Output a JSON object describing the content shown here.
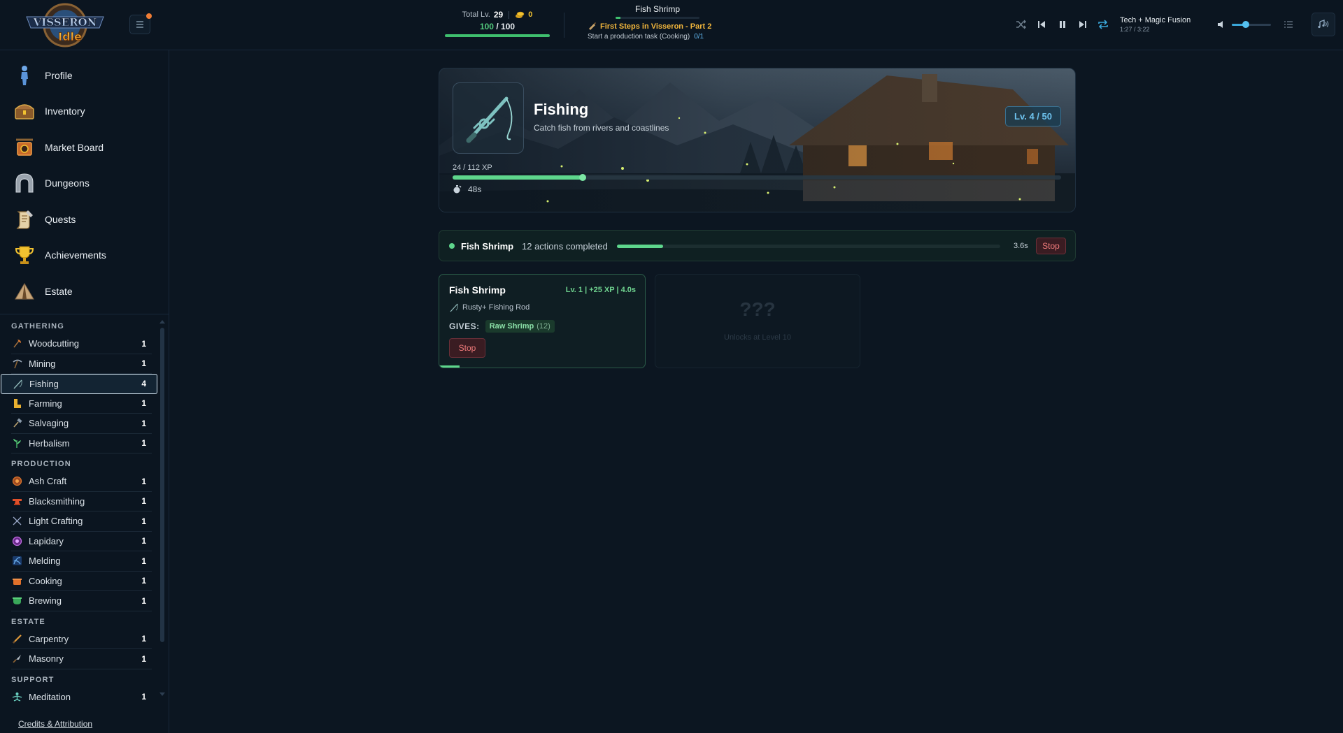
{
  "header": {
    "total_level_label": "Total Lv.",
    "total_level": "29",
    "gold": "0",
    "energy_current": "100",
    "energy_separator": "/",
    "energy_max": "100",
    "energy_fraction": 1.0,
    "current_action": "Fish Shrimp",
    "quest_progress_fraction": 0.06,
    "quest_name": "First Steps in Visseron - Part 2",
    "quest_task": "Start a production task (Cooking)",
    "quest_task_progress": "0/1",
    "player": {
      "track_title": "Tech + Magic Fusion",
      "track_time": "1:27 / 3:22",
      "volume_fraction": 0.35
    }
  },
  "sidebar": {
    "nav": [
      {
        "label": "Profile",
        "icon": "person-icon"
      },
      {
        "label": "Inventory",
        "icon": "chest-icon"
      },
      {
        "label": "Market Board",
        "icon": "market-icon"
      },
      {
        "label": "Dungeons",
        "icon": "gate-icon"
      },
      {
        "label": "Quests",
        "icon": "scroll-icon"
      },
      {
        "label": "Achievements",
        "icon": "trophy-icon"
      },
      {
        "label": "Estate",
        "icon": "tent-icon"
      }
    ],
    "sections": {
      "gathering": "GATHERING",
      "production": "PRODUCTION",
      "estate": "ESTATE",
      "support": "SUPPORT"
    },
    "gathering": [
      {
        "label": "Woodcutting",
        "level": "1"
      },
      {
        "label": "Mining",
        "level": "1"
      },
      {
        "label": "Fishing",
        "level": "4"
      },
      {
        "label": "Farming",
        "level": "1"
      },
      {
        "label": "Salvaging",
        "level": "1"
      },
      {
        "label": "Herbalism",
        "level": "1"
      }
    ],
    "production": [
      {
        "label": "Ash Craft",
        "level": "1"
      },
      {
        "label": "Blacksmithing",
        "level": "1"
      },
      {
        "label": "Light Crafting",
        "level": "1"
      },
      {
        "label": "Lapidary",
        "level": "1"
      },
      {
        "label": "Melding",
        "level": "1"
      },
      {
        "label": "Cooking",
        "level": "1"
      },
      {
        "label": "Brewing",
        "level": "1"
      }
    ],
    "estate": [
      {
        "label": "Carpentry",
        "level": "1"
      },
      {
        "label": "Masonry",
        "level": "1"
      }
    ],
    "support": [
      {
        "label": "Meditation",
        "level": "1"
      }
    ],
    "credits": "Credits & Attribution"
  },
  "hero": {
    "name": "Fishing",
    "description": "Catch fish from rivers and coastlines",
    "level_badge": "Lv. 4 / 50",
    "xp_text": "24 / 112 XP",
    "xp_fraction": 0.214,
    "timer": "48s"
  },
  "active_task": {
    "name": "Fish Shrimp",
    "count": "12 actions completed",
    "progress_fraction": 0.12,
    "time": "3.6s",
    "stop_label": "Stop"
  },
  "cards": {
    "action": {
      "name": "Fish Shrimp",
      "meta": "Lv. 1 | +25 XP | 4.0s",
      "tool": "Rusty+ Fishing Rod",
      "gives_label": "GIVES:",
      "item_name": "Raw Shrimp",
      "item_qty": "(12)",
      "stop_label": "Stop",
      "progress_fraction": 0.1
    },
    "locked": {
      "mystery": "???",
      "unlock_text": "Unlocks at Level 10"
    }
  },
  "colors": {
    "accent_green": "#5ed68c",
    "accent_blue": "#6ec3ee",
    "stop_red": "#f07b7b",
    "gold": "#f2c230",
    "quest_orange": "#f2b63c"
  }
}
